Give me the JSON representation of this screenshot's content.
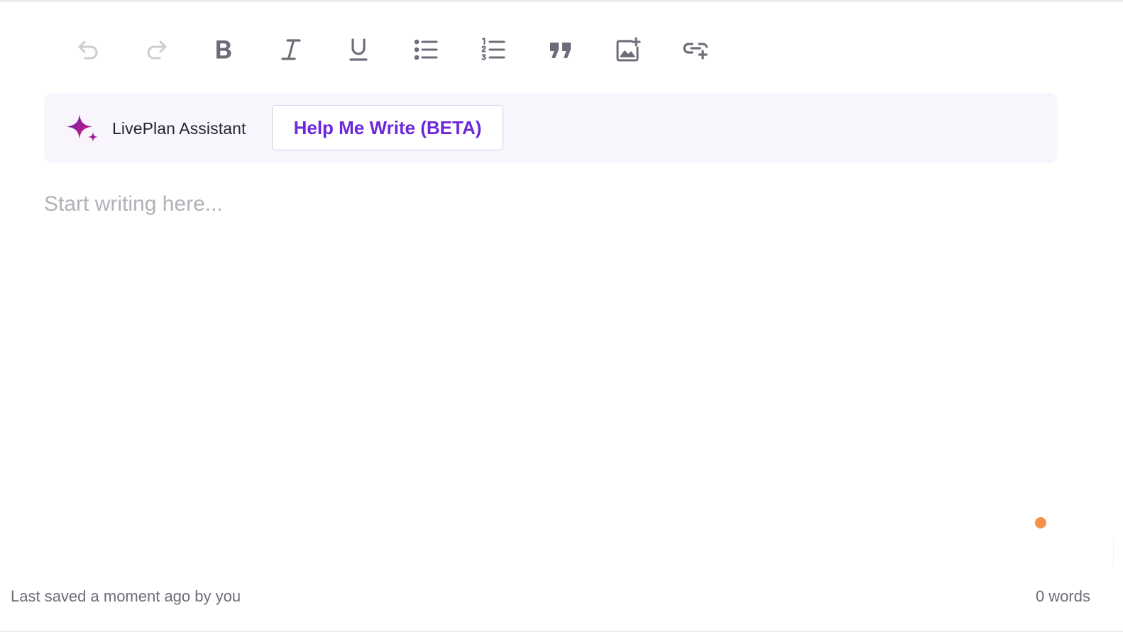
{
  "toolbar": {
    "buttons": [
      {
        "icon": "undo-icon",
        "state": "disabled"
      },
      {
        "icon": "redo-icon",
        "state": "disabled"
      },
      {
        "icon": "bold-icon",
        "state": "enabled"
      },
      {
        "icon": "italic-icon",
        "state": "enabled"
      },
      {
        "icon": "underline-icon",
        "state": "enabled"
      },
      {
        "icon": "bulleted-list-icon",
        "state": "enabled"
      },
      {
        "icon": "numbered-list-icon",
        "state": "enabled"
      },
      {
        "icon": "blockquote-icon",
        "state": "enabled"
      },
      {
        "icon": "insert-image-icon",
        "state": "enabled"
      },
      {
        "icon": "insert-link-icon",
        "state": "enabled"
      }
    ],
    "icon_color": "#6b6e78",
    "disabled_icon_color": "#a9acb4"
  },
  "assistant": {
    "icon": "sparkle-icon",
    "label": "LivePlan Assistant",
    "button_label": "Help Me Write (BETA)",
    "accent_color": "#6d28d9",
    "background_color": "#f8f5fc"
  },
  "editor": {
    "placeholder": "Start writing here..."
  },
  "status": {
    "dot_color": "#f5914a"
  },
  "footer": {
    "last_saved": "Last saved a moment ago by you",
    "word_count": "0 words"
  }
}
